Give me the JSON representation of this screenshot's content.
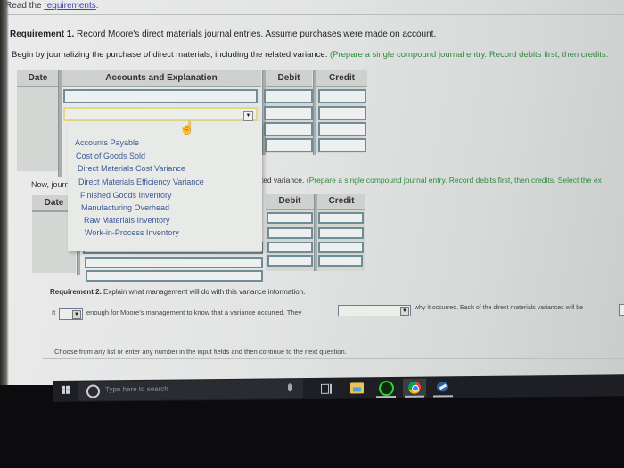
{
  "header": {
    "read_prefix": "Read the",
    "requirements_link": "requirements",
    "read_suffix": "."
  },
  "requirement1": {
    "label": "Requirement 1.",
    "text": "Record Moore's direct materials journal entries. Assume purchases were made on account.",
    "begin_text": "Begin by journalizing the purchase of direct materials, including the related variance.",
    "begin_instruction": "(Prepare a single compound journal entry. Record debits first, then credits.",
    "now_text": "Now, journa",
    "now_tail_text": "ated variance.",
    "now_instruction": "(Prepare a single compound journal entry. Record debits first, then credits. Select the ex"
  },
  "journal_table_1": {
    "columns": [
      "Date",
      "Accounts and Explanation",
      "Debit",
      "Credit"
    ]
  },
  "journal_table_2": {
    "columns": [
      "Date",
      "Debit",
      "Credit"
    ]
  },
  "account_dropdown": {
    "selected": "",
    "options": [
      "Accounts Payable",
      "Cost of Goods Sold",
      "Direct Materials Cost Variance",
      "Direct Materials Efficiency Variance",
      "Finished Goods Inventory",
      "Manufacturing Overhead",
      "Raw Materials Inventory",
      "Work-in-Process Inventory"
    ]
  },
  "requirement2": {
    "label": "Requirement 2.",
    "text": "Explain what management will do with this variance information.",
    "it_prefix": "It",
    "sentence_part1": "enough for Moore's management to know that a variance occurred. They",
    "sentence_part2": "why it occurred. Each of the direct materials variances will be",
    "select1_value": "",
    "select2_value": ""
  },
  "footer": {
    "hint": "Choose from any list or enter any number in the input fields and then continue to the next question."
  },
  "taskbar": {
    "search_placeholder": "Type here to search",
    "apps": [
      "task-view",
      "file-explorer",
      "razer-cortex",
      "chrome",
      "steam"
    ]
  },
  "colors": {
    "instruction_green": "#2f8a3c",
    "link_blue": "#3847b4",
    "dropdown_text": "#3c5a92",
    "input_border": "#6f8c97",
    "taskbar": "#1e1f24"
  }
}
